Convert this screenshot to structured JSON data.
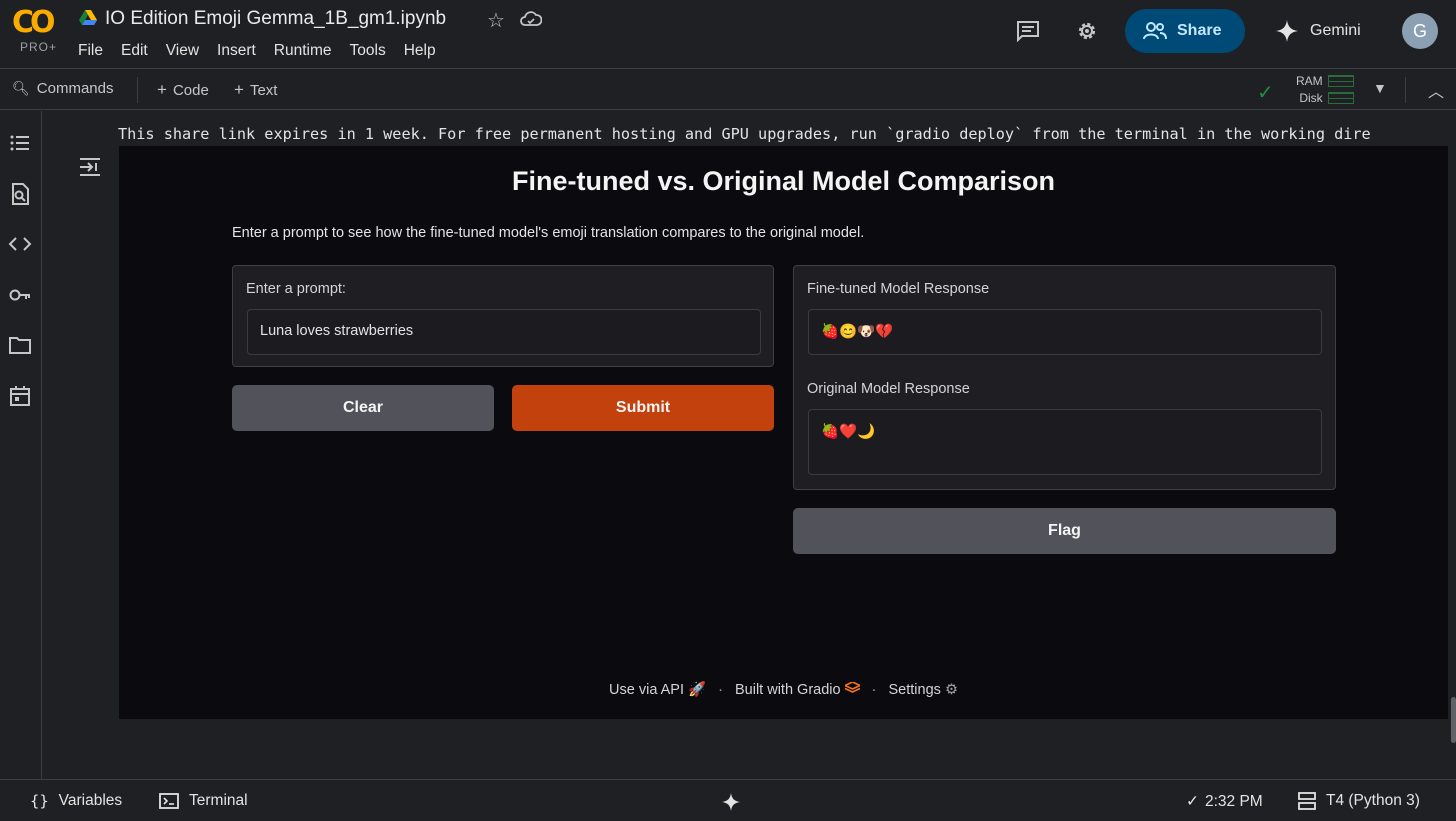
{
  "header": {
    "logo_text": "CO",
    "logo_badge": "PRO+",
    "notebook_title": "IO Edition Emoji Gemma_1B_gm1.ipynb",
    "menu": [
      "File",
      "Edit",
      "View",
      "Insert",
      "Runtime",
      "Tools",
      "Help"
    ],
    "share_label": "Share",
    "gemini_label": "Gemini",
    "avatar_initial": "G"
  },
  "toolbar": {
    "commands_label": "Commands",
    "code_label": "Code",
    "text_label": "Text",
    "ram_label": "RAM",
    "disk_label": "Disk"
  },
  "sidebar": {
    "icons": [
      "table-of-contents-icon",
      "find-icon",
      "code-snippets-icon",
      "secrets-key-icon",
      "files-folder-icon",
      "calendar-icon"
    ]
  },
  "cell_output": {
    "share_text": "This share link expires in 1 week. For free permanent hosting and GPU upgrades, run `gradio deploy` from the terminal in the working dire"
  },
  "gradio": {
    "title": "Fine-tuned vs. Original Model Comparison",
    "description": "Enter a prompt to see how the fine-tuned model's emoji translation compares to the original model.",
    "prompt_label": "Enter a prompt:",
    "prompt_value": "Luna loves strawberries",
    "clear_label": "Clear",
    "submit_label": "Submit",
    "finetuned_label": "Fine-tuned Model Response",
    "finetuned_value": "🍓😊🐶💔",
    "original_label": "Original Model Response",
    "original_value": "🍓❤️🌙",
    "flag_label": "Flag",
    "footer": {
      "api_label": "Use via API",
      "api_emoji": "🚀",
      "built_label": "Built with Gradio",
      "settings_label": "Settings"
    }
  },
  "statusbar": {
    "variables_label": "Variables",
    "terminal_label": "Terminal",
    "time": "2:32 PM",
    "runtime": "T4 (Python 3)"
  },
  "colors": {
    "accent_primary": "#c2410c",
    "share_bg": "#004a77",
    "brand_orange": "#f9ab00"
  }
}
